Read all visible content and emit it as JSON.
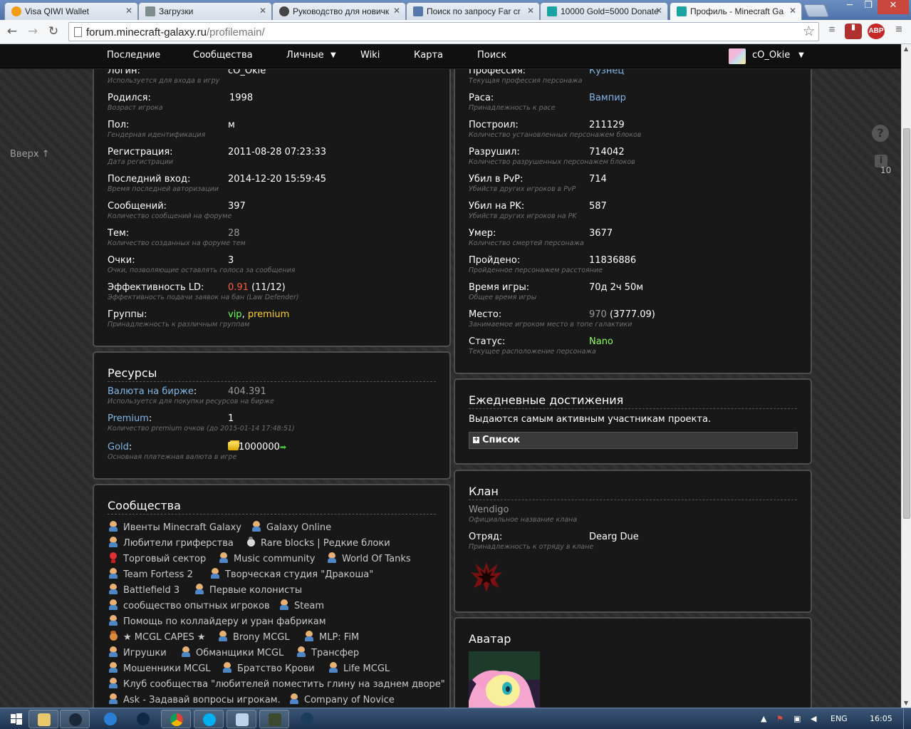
{
  "browser": {
    "tabs": [
      {
        "title": "Visa QIWI Wallet",
        "color": "#f39c12"
      },
      {
        "title": "Загрузки",
        "color": "#7f8c8d"
      },
      {
        "title": "Руководство для новичк",
        "color": "#444444"
      },
      {
        "title": "Поиск по запросу Far cr",
        "color": "#5577aa"
      },
      {
        "title": "10000 Gold=5000 Donate",
        "color": "#1aa3a3"
      },
      {
        "title": "Профиль - Minecraft Ga",
        "color": "#1aa3a3"
      }
    ],
    "url_host": "forum.minecraft-galaxy.ru",
    "url_path": "/profilemain/",
    "ext_abp": "ABP"
  },
  "nav": {
    "items": [
      "Последние",
      "Сообщества",
      "Личные",
      "Wiki",
      "Карта",
      "Поиск"
    ],
    "username": "cO_Okie",
    "caret": "▼"
  },
  "sidebar": {
    "up_link": "Вверх ↑",
    "help": "?",
    "info": "i",
    "notif_count": "10"
  },
  "profile_left": [
    {
      "label": "Логин:",
      "value": "cO_Okie",
      "hint": "Используется для входа в игру"
    },
    {
      "label": "Родился:",
      "value": "1998",
      "hint": "Возраст игрока"
    },
    {
      "label": "Пол:",
      "value": "м",
      "hint": "Гендерная идентификация"
    },
    {
      "label": "Регистрация:",
      "value": "2011-08-28 07:23:33",
      "hint": "Дата регистрации"
    },
    {
      "label": "Последний вход:",
      "value": "2014-12-20 15:59:45",
      "hint": "Время последней авторизации"
    },
    {
      "label": "Сообщений:",
      "value": "397",
      "hint": "Количество сообщений на форуме"
    },
    {
      "label": "Тем:",
      "value": "28",
      "hint": "Количество созданных на форуме тем"
    },
    {
      "label": "Очки:",
      "value": "3",
      "hint": "Очки, позволяющие оставлять голоса за сообщения"
    },
    {
      "label": "Эффективность LD:",
      "value_red": "0.91",
      "value": "(11/12)",
      "hint": "Эффективность подачи заявок на бан (Law Defender)"
    },
    {
      "label": "Группы:",
      "value_green": "vip",
      "value_sep": ", ",
      "value_yellow": "premium",
      "hint": "Принадлежность к различным группам"
    }
  ],
  "profile_right": [
    {
      "label": "Профессия:",
      "value": "Кузнец",
      "hint": "Текущая профессия персонажа"
    },
    {
      "label": "Раса:",
      "value": "Вампир",
      "hint": "Принадлежность к расе"
    },
    {
      "label": "Построил:",
      "value": "211129",
      "hint": "Количество установленных персонажем блоков"
    },
    {
      "label": "Разрушил:",
      "value": "714042",
      "hint": "Количество разрушенных персонажем блоков"
    },
    {
      "label": "Убил в PvP:",
      "value": "714",
      "hint": "Убийств других игроков в PvP"
    },
    {
      "label": "Убил на PK:",
      "value": "587",
      "hint": "Убийств других игроков на PK"
    },
    {
      "label": "Умер:",
      "value": "3677",
      "hint": "Количество смертей персонажа"
    },
    {
      "label": "Пройдено:",
      "value": "11836886",
      "hint": "Пройденное персонажем расстояние"
    },
    {
      "label": "Время игры:",
      "value": "70д 2ч 50м",
      "hint": "Общее время игры"
    },
    {
      "label": "Место:",
      "value_grey": "970",
      "value": "(3777.09)",
      "hint": "Занимаемое игроком место в топе галактики"
    },
    {
      "label": "Статус:",
      "value": "Nano",
      "hint": "Текущее расположение персонажа"
    }
  ],
  "resources": {
    "title": "Ресурсы",
    "rows": [
      {
        "label": "Валюта на бирже",
        "colon": ":",
        "value": "404.391",
        "hint": "Используется для покупки ресурсов на бирже"
      },
      {
        "label": "Premium",
        "colon": ":",
        "value": "1",
        "hint": "Количество premium очков (до 2015-01-14 17:48:51)"
      },
      {
        "label": "Gold",
        "colon": ":",
        "value": "1000000",
        "hint": "Основная платежная валюта в игре"
      }
    ]
  },
  "communities": {
    "title": "Сообщества",
    "items": [
      "Ивенты Minecraft Galaxy",
      "Galaxy Online",
      "Любители гриферства",
      "Rare blocks | Редкие блоки",
      "Торговый сектор",
      "Music community",
      "World Of Tanks",
      "Team Fortess 2",
      "Творческая студия \"Дракоша\"",
      "Battlefield 3",
      "Первые колонисты",
      "сообщество опытных игроков",
      "Steam",
      "Помощь по коллайдеру и уран фабрикам",
      "★ MCGL CAPES ★",
      "Brony MCGL",
      "MLP: FiM",
      "Игрушки",
      "Обманщики MCGL",
      "Трансфер",
      "Мошенники MCGL",
      "Братство Крови",
      "Life MCGL",
      "Клуб сообщества \"любителей поместить глину на заднем дворе\"",
      "Ask - Задавай вопросы игрокам.",
      "Company of Novice"
    ]
  },
  "daily": {
    "title": "Ежедневные достижения",
    "desc": "Выдаются самым активным участникам проекта.",
    "list_label": "Список",
    "plus": "+"
  },
  "clan": {
    "title": "Клан",
    "name": "Wendigo",
    "name_hint": "Официальное название клана",
    "squad_label": "Отряд:",
    "squad_value": "Dearg Due",
    "squad_hint": "Принадлежность к отряду в клане"
  },
  "avatar": {
    "title": "Аватар"
  },
  "taskbar": {
    "lang": "ENG",
    "time": "16:05"
  }
}
